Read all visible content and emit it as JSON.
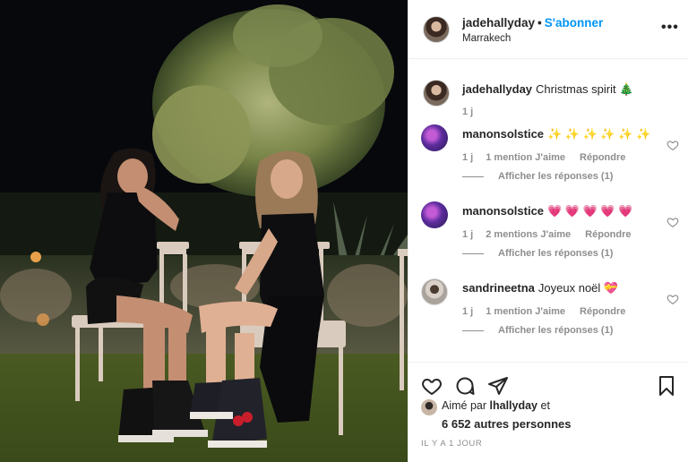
{
  "photo": {
    "alt_subject": "two-women-sitting-on-chairs-at-night",
    "sky_color": "#07080c",
    "grass_color": "#3a4a1c",
    "tree_color": "#8f9a5a"
  },
  "post": {
    "username": "jadehallyday",
    "separator": "•",
    "follow_label": "S'abonner",
    "location": "Marrakech",
    "more_icon": "more-options-icon"
  },
  "comments": [
    {
      "username": "jadehallyday",
      "text": "Christmas spirit 🎄",
      "time": "1 j",
      "is_caption": true
    },
    {
      "username": "manonsolstice",
      "text": "✨ ✨ ✨ ✨ ✨ ✨",
      "time": "1 j",
      "likes": "1 mention J'aime",
      "reply": "Répondre",
      "view_replies": "Afficher les réponses (1)"
    },
    {
      "username": "manonsolstice",
      "text": "💗 💗 💗 💗 💗",
      "time": "1 j",
      "likes": "2 mentions J'aime",
      "reply": "Répondre",
      "view_replies": "Afficher les réponses (1)"
    },
    {
      "username": "sandrineetna",
      "text": "Joyeux noël 💝",
      "time": "1 j",
      "likes": "1 mention J'aime",
      "reply": "Répondre",
      "view_replies": "Afficher les réponses (1)"
    }
  ],
  "actions": {
    "like_icon": "heart-icon",
    "comment_icon": "comment-icon",
    "share_icon": "share-icon",
    "save_icon": "bookmark-icon"
  },
  "likes": {
    "prefix": "Aimé par",
    "user": "lhallyday",
    "conj": "et",
    "count_text": "6 652 autres personnes"
  },
  "time_ago": "IL Y A 1 JOUR",
  "colors": {
    "link": "#0095f6",
    "text": "#262626",
    "muted": "#8e8e8e",
    "border": "#efefef"
  }
}
